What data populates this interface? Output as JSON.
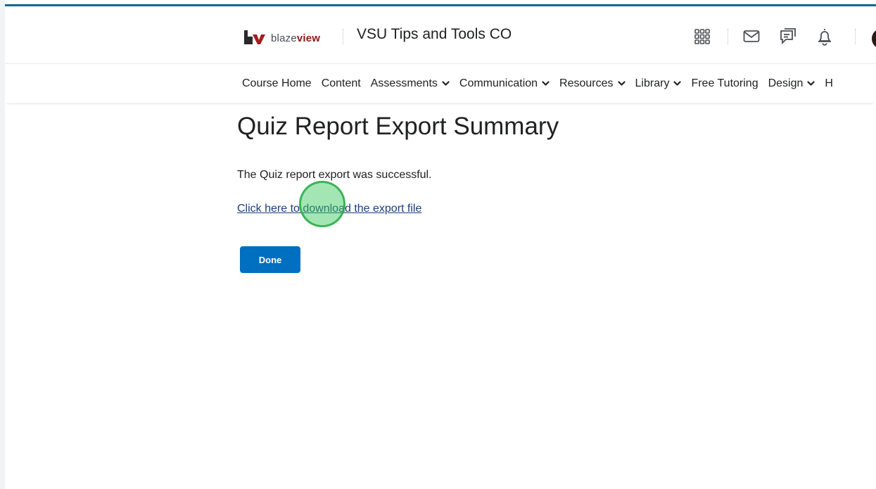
{
  "brand": {
    "logo_mark": "bv",
    "word_prefix": "blaze",
    "word_suffix": "view"
  },
  "header": {
    "course_title": "VSU Tips and Tools CO",
    "icons": [
      "waffle-grid-icon",
      "mail-icon",
      "chat-icon",
      "bell-icon"
    ]
  },
  "nav": {
    "items": [
      {
        "label": "Course Home",
        "dropdown": false
      },
      {
        "label": "Content",
        "dropdown": false
      },
      {
        "label": "Assessments",
        "dropdown": true
      },
      {
        "label": "Communication",
        "dropdown": true
      },
      {
        "label": "Resources",
        "dropdown": true
      },
      {
        "label": "Library",
        "dropdown": true
      },
      {
        "label": "Free Tutoring",
        "dropdown": false
      },
      {
        "label": "Design",
        "dropdown": true
      },
      {
        "label": "H",
        "dropdown": false
      }
    ]
  },
  "main": {
    "title": "Quiz Report Export Summary",
    "message": "The Quiz report export was successful.",
    "download_link": "Click here to download the export file",
    "done_label": "Done"
  },
  "colors": {
    "accent": "#006b8f",
    "button": "#006fbf",
    "link": "#1b3e7a",
    "brand_red": "#8b1a1a"
  }
}
